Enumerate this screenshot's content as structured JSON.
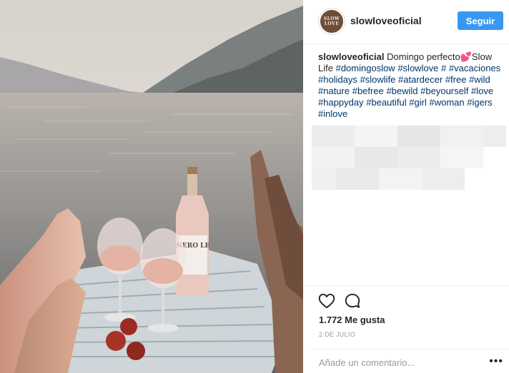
{
  "post": {
    "username": "slowloveoficial",
    "avatar_text_top": "SLOW",
    "avatar_text_bottom": "LOVE",
    "follow_label": "Seguir",
    "caption_user": "slowloveoficial",
    "caption_text": "Domingo perfecto",
    "caption_emoji": "💕",
    "caption_after_emoji": "Slow Life",
    "hashtags": [
      "#domingoslow",
      "#slowlove",
      "#",
      "#vacaciones",
      "#holidays",
      "#slowlife",
      "#atardecer",
      "#free",
      "#wild",
      "#nature",
      "#befree",
      "#bewild",
      "#beyourself",
      "#love",
      "#happyday",
      "#beautiful",
      "#girl",
      "#woman",
      "#igers",
      "#inlove"
    ],
    "likes": "1.772 Me gusta",
    "date": "2 DE JULIO",
    "comment_placeholder": "Añade un comentario...",
    "more_label": "•••",
    "photo_label": "NERO LE"
  },
  "icons": {
    "like": "heart-icon",
    "comment": "comment-icon",
    "more": "more-options-icon"
  },
  "colors": {
    "follow_button": "#3897f0",
    "hashtag": "#003569",
    "avatar": "#6d4e38"
  }
}
